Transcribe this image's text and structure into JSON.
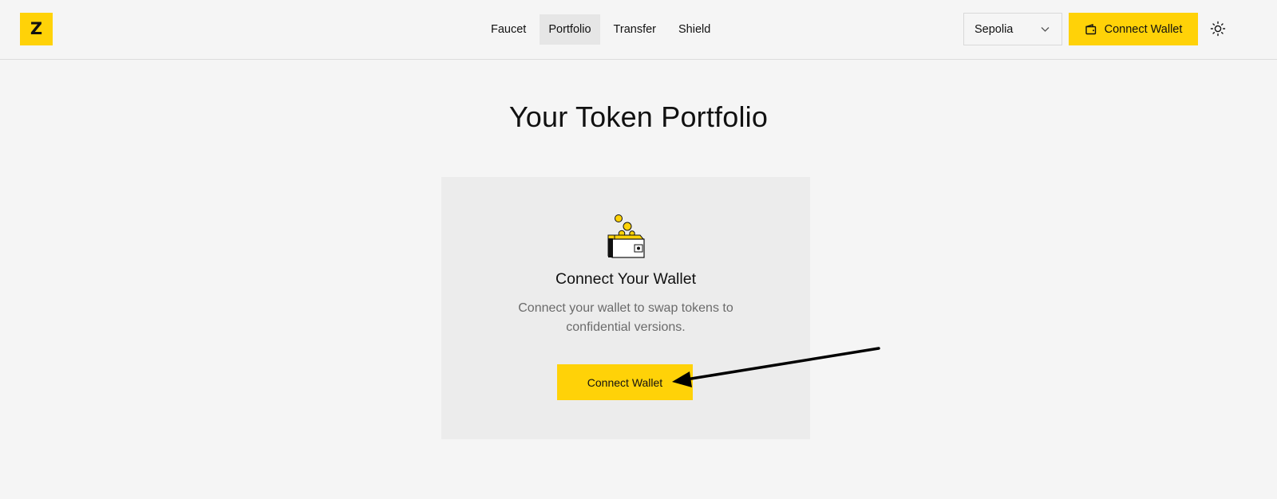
{
  "brand": {
    "logo_glyph": "Z",
    "accent_color": "#ffd208"
  },
  "nav": {
    "items": [
      {
        "label": "Faucet",
        "active": false
      },
      {
        "label": "Portfolio",
        "active": true
      },
      {
        "label": "Transfer",
        "active": false
      },
      {
        "label": "Shield",
        "active": false
      }
    ]
  },
  "network": {
    "selected": "Sepolia",
    "icon": "chevron-down-icon"
  },
  "header": {
    "connect_label": "Connect Wallet",
    "wallet_icon": "wallet-icon",
    "theme_icon": "sun-icon"
  },
  "main": {
    "title": "Your Token Portfolio",
    "card": {
      "illustration": "wallet-coins-icon",
      "title": "Connect Your Wallet",
      "description": "Connect your wallet to swap tokens to confidential versions.",
      "button_label": "Connect Wallet"
    }
  },
  "colors": {
    "background": "#f5f5f5",
    "card": "#ececec",
    "muted_text": "#6b6b6b"
  }
}
